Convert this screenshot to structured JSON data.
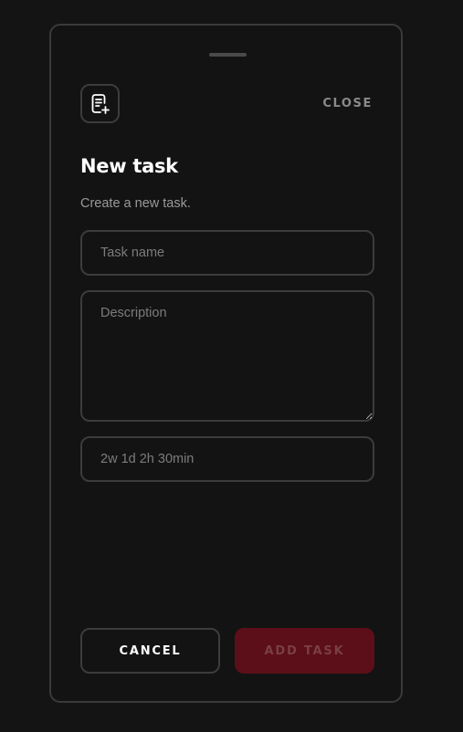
{
  "dialog": {
    "close_label": "CLOSE",
    "title": "New task",
    "subtitle": "Create a new task.",
    "task_name": {
      "placeholder": "Task name",
      "value": ""
    },
    "description": {
      "placeholder": "Description",
      "value": ""
    },
    "duration": {
      "placeholder": "2w 1d 2h 30min",
      "value": ""
    },
    "cancel_label": "CANCEL",
    "add_label": "ADD TASK",
    "add_disabled": true
  },
  "icons": {
    "header": "task-add-icon"
  },
  "colors": {
    "background": "#141414",
    "border": "#3c3c3c",
    "primary_disabled_bg": "#5c0f18",
    "primary_disabled_text": "#7a3e45"
  }
}
